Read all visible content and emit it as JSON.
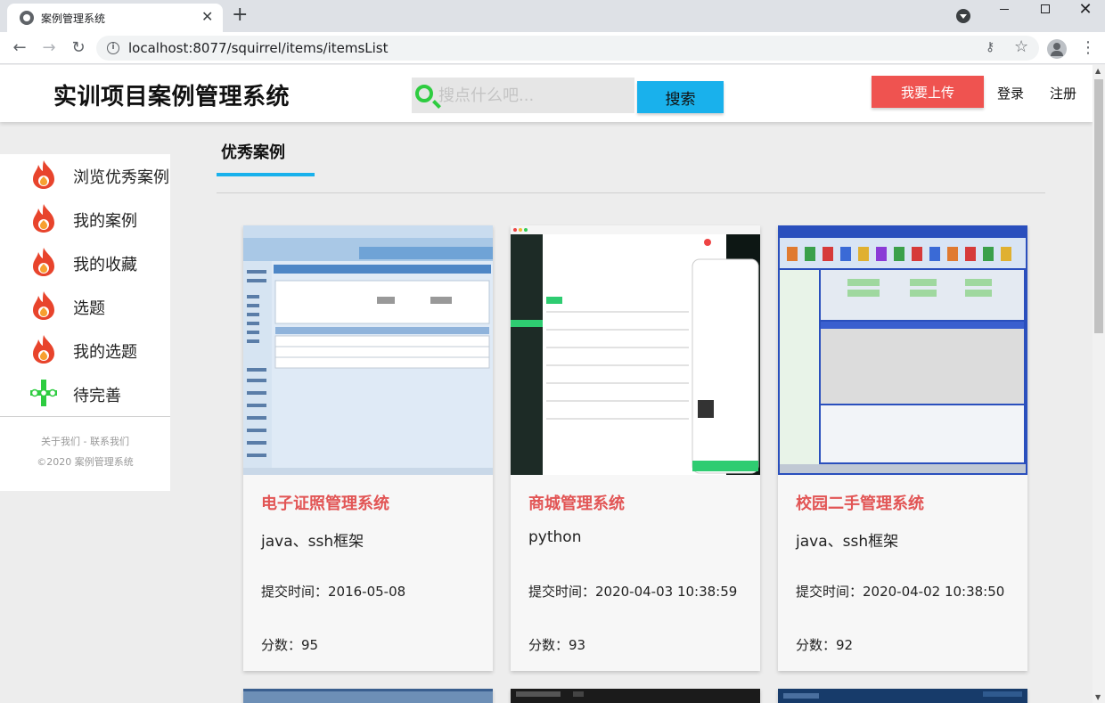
{
  "browser": {
    "tab_title": "案例管理系统",
    "tab_close": "✕",
    "new_tab": "+",
    "url": "localhost:8077/squirrel/items/itemsList",
    "back": "←",
    "forward": "→",
    "reload": "↻",
    "key_icon": "⚷",
    "star_icon": "☆",
    "menu_icon": "⋮",
    "win_close": "✕"
  },
  "header": {
    "brand": "实训项目案例管理系统",
    "search_placeholder": "搜点什么吧...",
    "search_button": "搜索",
    "upload_button": "我要上传",
    "login": "登录",
    "register": "注册"
  },
  "sidebar": {
    "items": [
      {
        "label": "浏览优秀案例",
        "icon": "flame-icon"
      },
      {
        "label": "我的案例",
        "icon": "flame-icon"
      },
      {
        "label": "我的收藏",
        "icon": "flame-icon"
      },
      {
        "label": "选题",
        "icon": "flame-icon"
      },
      {
        "label": "我的选题",
        "icon": "flame-icon"
      },
      {
        "label": "待完善",
        "icon": "cross-dots-icon"
      }
    ],
    "footer_links": "关于我们 - 联系我们",
    "copyright": "©2020 案例管理系统"
  },
  "section": {
    "title": "优秀案例"
  },
  "cards": [
    {
      "title": "电子证照管理系统",
      "tech": "java、ssh框架",
      "time": "提交时间：2016-05-08",
      "score": "分数：95"
    },
    {
      "title": "商城管理系统",
      "tech": "python",
      "time": "提交时间：2020-04-03 10:38:59",
      "score": "分数：93"
    },
    {
      "title": "校园二手管理系统",
      "tech": "java、ssh框架",
      "time": "提交时间：2020-04-02 10:38:50",
      "score": "分数：92"
    }
  ],
  "colors": {
    "accent_blue": "#19b1ec",
    "upload_red": "#ef5350",
    "card_title_red": "#e25555",
    "flame_red": "#e8442c",
    "flame_orange": "#f7a030",
    "green": "#2ecc40"
  }
}
